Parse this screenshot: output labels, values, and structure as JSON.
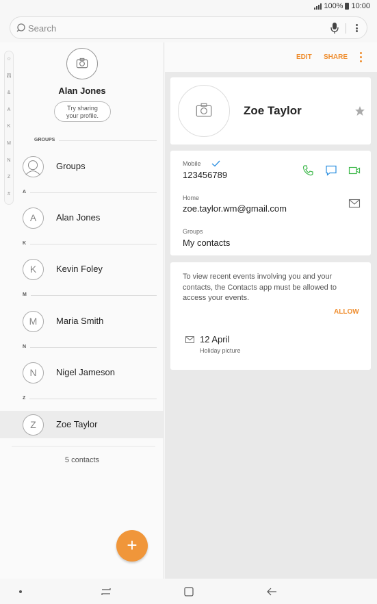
{
  "status_bar": {
    "battery": "100%",
    "time": "10:00"
  },
  "search": {
    "placeholder": "Search"
  },
  "index_bar": [
    "☆",
    "四",
    "&",
    "A",
    "K",
    "M",
    "N",
    "Z",
    "#"
  ],
  "profile": {
    "name": "Alan Jones",
    "share_button": "Try sharing\nyour profile."
  },
  "groups_section": {
    "header": "GROUPS",
    "item_label": "Groups"
  },
  "sections": [
    {
      "letter": "A",
      "contact": {
        "initial": "A",
        "name": "Alan Jones"
      }
    },
    {
      "letter": "K",
      "contact": {
        "initial": "K",
        "name": "Kevin Foley"
      }
    },
    {
      "letter": "M",
      "contact": {
        "initial": "M",
        "name": "Maria Smith"
      }
    },
    {
      "letter": "N",
      "contact": {
        "initial": "N",
        "name": "Nigel Jameson"
      }
    },
    {
      "letter": "Z",
      "contact": {
        "initial": "Z",
        "name": "Zoe Taylor",
        "selected": true
      }
    }
  ],
  "contact_count": "5 contacts",
  "fab": {
    "label": "+"
  },
  "detail": {
    "toolbar": {
      "edit": "EDIT",
      "share": "SHARE"
    },
    "name": "Zoe Taylor",
    "mobile_label": "Mobile",
    "mobile": "123456789",
    "email_label": "Home",
    "email": "zoe.taylor.wm@gmail.com",
    "groups_label": "Groups",
    "groups": "My contacts",
    "events_message": "To view recent events involving you and your contacts, the Contacts app must be allowed to access your events.",
    "allow": "ALLOW",
    "event": {
      "date": "12 April",
      "description": "Holiday picture"
    }
  },
  "colors": {
    "accent": "#ef8d2d",
    "call": "#3db84a",
    "message": "#2a8ee0",
    "video": "#3db84a"
  },
  "icons": [
    "search-icon",
    "mic-icon",
    "more-vert-icon",
    "camera-icon",
    "groups-icon",
    "star-icon",
    "check-icon",
    "phone-icon",
    "message-icon",
    "video-icon",
    "mail-icon",
    "add-icon",
    "recents-icon",
    "home-icon",
    "back-icon"
  ]
}
